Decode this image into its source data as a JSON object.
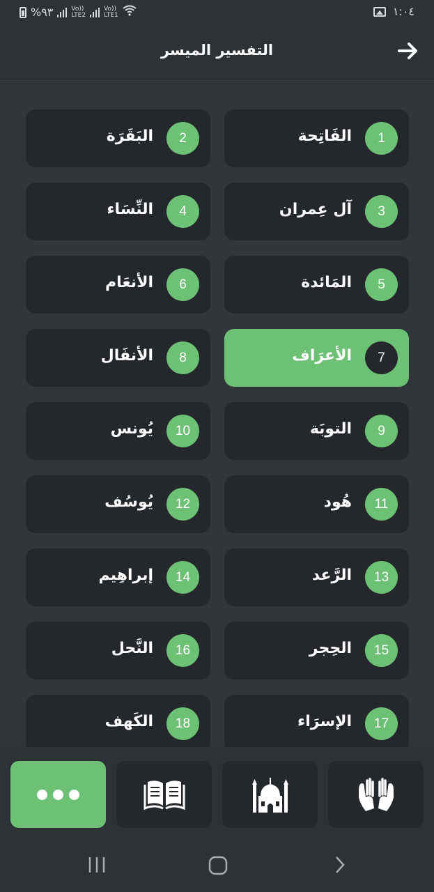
{
  "status_bar": {
    "battery": "%٩٣",
    "sim1": "LTE2",
    "sim2": "LTE1",
    "volte": "Vo))",
    "time": "١:٠٤"
  },
  "header": {
    "title": "التفسير الميسر",
    "back_icon": "arrow-right-icon"
  },
  "surahs": [
    {
      "num": "1",
      "name": "الفَاتِحة",
      "active": false
    },
    {
      "num": "2",
      "name": "البَقَرَة",
      "active": false
    },
    {
      "num": "3",
      "name": "آل عِمران",
      "active": false
    },
    {
      "num": "4",
      "name": "النِّسَاء",
      "active": false
    },
    {
      "num": "5",
      "name": "المَائدة",
      "active": false
    },
    {
      "num": "6",
      "name": "الأنعَام",
      "active": false
    },
    {
      "num": "7",
      "name": "الأعرَاف",
      "active": true
    },
    {
      "num": "8",
      "name": "الأنفَال",
      "active": false
    },
    {
      "num": "9",
      "name": "التوبَة",
      "active": false
    },
    {
      "num": "10",
      "name": "يُونس",
      "active": false
    },
    {
      "num": "11",
      "name": "هُود",
      "active": false
    },
    {
      "num": "12",
      "name": "يُوسُف",
      "active": false
    },
    {
      "num": "13",
      "name": "الرَّعد",
      "active": false
    },
    {
      "num": "14",
      "name": "إبراهِيم",
      "active": false
    },
    {
      "num": "15",
      "name": "الحِجر",
      "active": false
    },
    {
      "num": "16",
      "name": "النَّحل",
      "active": false
    },
    {
      "num": "17",
      "name": "الإسرَاء",
      "active": false
    },
    {
      "num": "18",
      "name": "الكَهف",
      "active": false
    }
  ],
  "bottom_nav": {
    "items": [
      {
        "icon": "more-dots-icon",
        "active": true
      },
      {
        "icon": "open-book-icon",
        "active": false
      },
      {
        "icon": "mosque-icon",
        "active": false
      },
      {
        "icon": "praying-hands-icon",
        "active": false
      }
    ]
  },
  "colors": {
    "accent": "#6dc175",
    "card": "#24282c",
    "background": "#31363b",
    "bar": "#2d3237"
  }
}
